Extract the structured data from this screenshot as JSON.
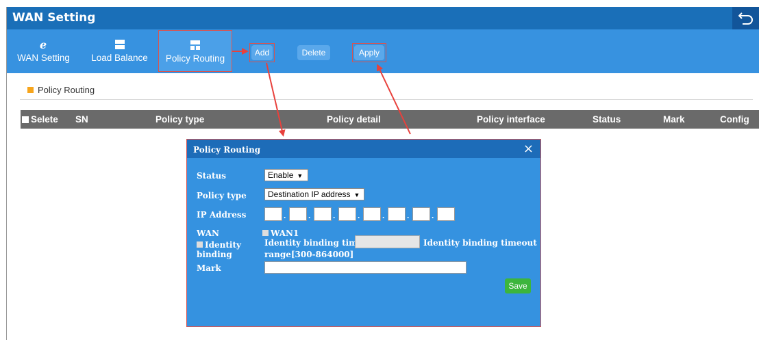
{
  "window": {
    "title": "WAN Setting",
    "back_icon": "return-arrow-icon"
  },
  "nav": {
    "items": [
      {
        "label": "WAN Setting",
        "icon": "ie-icon"
      },
      {
        "label": "Load Balance",
        "icon": "load-balance-icon"
      },
      {
        "label": "Policy Routing",
        "icon": "policy-routing-icon"
      }
    ]
  },
  "toolbar": {
    "add_label": "Add",
    "delete_label": "Delete",
    "apply_label": "Apply"
  },
  "section": {
    "title": "Policy Routing"
  },
  "table": {
    "columns": [
      "Selete",
      "SN",
      "Policy type",
      "Policy detail",
      "Policy interface",
      "Status",
      "Mark",
      "Config"
    ]
  },
  "dialog": {
    "title": "Policy Routing",
    "close": "×",
    "status_label": "Status",
    "status_value": "Enable",
    "policy_type_label": "Policy type",
    "policy_type_value": "Destination IP address",
    "ip_label": "IP Address",
    "ip_octets": [
      "",
      "",
      "",
      "",
      "",
      "",
      "",
      ""
    ],
    "wan_label": "WAN",
    "wan_option": "WAN1",
    "identity_label_line1": "Identity",
    "identity_label_line2": "binding",
    "timeout_label": "Identity binding timeout",
    "timeout_range_line1": "Identity binding timeout",
    "timeout_range_line2": "range[300-864000]",
    "timeout_value": "",
    "mark_label": "Mark",
    "mark_value": "",
    "save_label": "Save"
  },
  "colors": {
    "titlebar": "#1a6fb8",
    "navbar": "#3792e0",
    "dialog_body": "#3592e0",
    "highlight": "#d9534f",
    "save": "#3cb53c",
    "section_marker": "#f7a51c",
    "table_header": "#6a6a6a"
  }
}
